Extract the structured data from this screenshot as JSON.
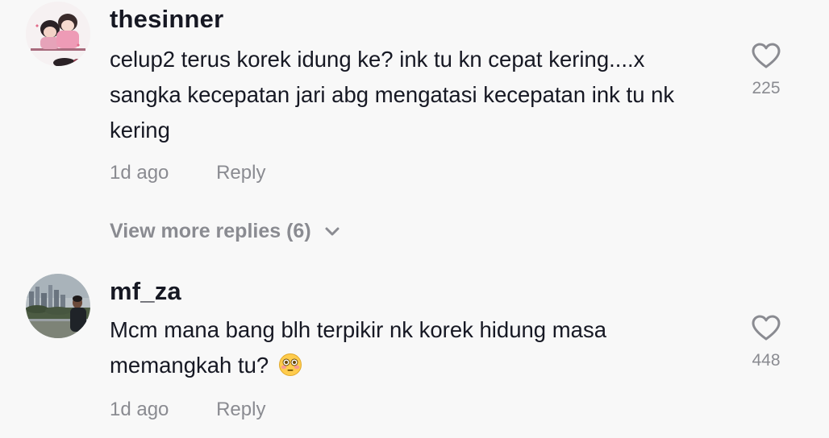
{
  "comments": [
    {
      "username": "thesinner",
      "text": "celup2 terus korek idung ke? ink tu kn cepat kering....x sangka kecepatan jari abg mengatasi kecepatan ink tu nk kering",
      "time": "1d ago",
      "reply_label": "Reply",
      "likes": "225",
      "like_icon": "heart-outline-icon"
    },
    {
      "username": "mf_za",
      "text": "Mcm mana bang blh terpikir nk korek hidung masa memangkah tu?",
      "emoji": "flushed-face-emoji",
      "time": "1d ago",
      "reply_label": "Reply",
      "likes": "448",
      "like_icon": "heart-outline-icon"
    }
  ],
  "view_more": {
    "label": "View more replies (6)",
    "icon": "chevron-down-icon"
  },
  "colors": {
    "background": "#f8f8f8",
    "primary_text": "#161823",
    "secondary_text": "#8a8b91"
  }
}
